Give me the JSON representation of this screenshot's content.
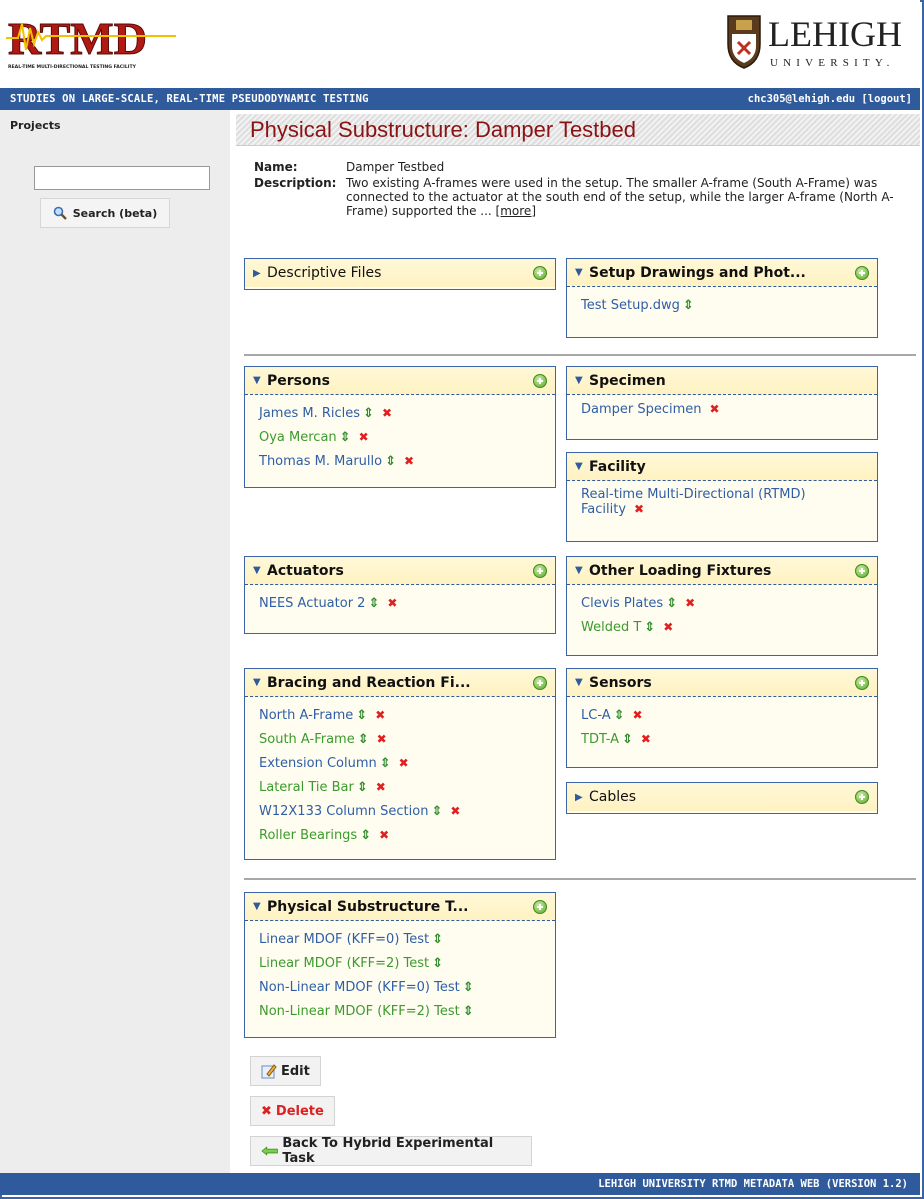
{
  "header": {
    "rtmd_logo_text": "RTMD",
    "rtmd_logo_sub": "REAL-TIME MULTI-DIRECTIONAL TESTING FACILITY",
    "lehigh_name": "LEHIGH",
    "lehigh_sub": "UNIVERSITY."
  },
  "titlebar": {
    "site_title": "STUDIES ON LARGE-SCALE, REAL-TIME PSEUDODYNAMIC TESTING",
    "user_email": "chc305@lehigh.edu",
    "logout": "[logout]"
  },
  "sidebar": {
    "projects_label": "Projects",
    "search_value": "",
    "search_button": "Search (beta)"
  },
  "page_title": "Physical Substructure: Damper Testbed",
  "info": {
    "name_label": "Name:",
    "name_value": "Damper Testbed",
    "description_label": "Description:",
    "description_value": "Two existing A-frames were used in the setup. The smaller A-frame (South A-Frame) was connected to the actuator at the south end of the setup, while the larger A-frame (North A-Frame) supported the ... ",
    "more_link": "[more]"
  },
  "panels": {
    "descriptive_files": {
      "title": "Descriptive Files"
    },
    "setup_drawings": {
      "title": "Setup Drawings and Phot...",
      "items": [
        "Test Setup.dwg"
      ]
    },
    "persons": {
      "title": "Persons",
      "items": [
        "James M. Ricles",
        "Oya Mercan",
        "Thomas M. Marullo"
      ]
    },
    "specimen": {
      "title": "Specimen",
      "items": [
        "Damper Specimen"
      ]
    },
    "facility": {
      "title": "Facility",
      "items": [
        "Real-time Multi-Directional (RTMD) Facility"
      ]
    },
    "actuators": {
      "title": "Actuators",
      "items": [
        "NEES Actuator 2"
      ]
    },
    "other_loading": {
      "title": "Other Loading Fixtures",
      "items": [
        "Clevis Plates",
        "Welded T"
      ]
    },
    "bracing": {
      "title": "Bracing and Reaction Fi...",
      "items": [
        "North A-Frame",
        "South A-Frame",
        "Extension Column",
        "Lateral Tie Bar",
        "W12X133 Column Section",
        "Roller Bearings"
      ]
    },
    "sensors": {
      "title": "Sensors",
      "items": [
        "LC-A",
        "TDT-A"
      ]
    },
    "cables": {
      "title": "Cables"
    },
    "physical_tests": {
      "title": "Physical Substructure T...",
      "items": [
        "Linear MDOF (KFF=0) Test",
        "Linear MDOF (KFF=2) Test",
        "Non-Linear MDOF (KFF=0) Test",
        "Non-Linear MDOF (KFF=2) Test"
      ]
    }
  },
  "buttons": {
    "edit": "Edit",
    "delete": "Delete",
    "back": "Back To Hybrid Experimental Task"
  },
  "footer": "LEHIGH UNIVERSITY RTMD METADATA WEB (VERSION 1.2)",
  "colors": {
    "accent": "#2f5a9c",
    "title_red": "#8b1212",
    "panel_bg": "#fffdf0",
    "delete_red": "#e02020",
    "add_green": "#5aa52c"
  }
}
